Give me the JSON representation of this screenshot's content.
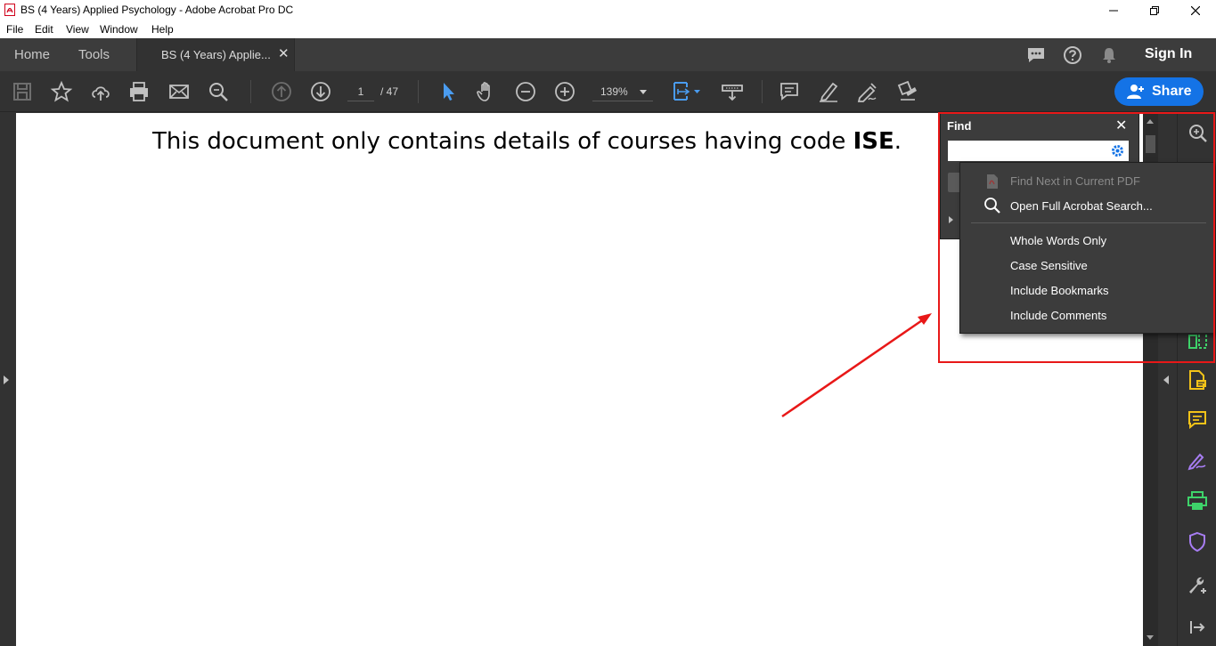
{
  "window": {
    "title": "BS (4 Years) Applied Psychology - Adobe Acrobat Pro DC",
    "controls": [
      "minimize",
      "restore",
      "close"
    ]
  },
  "menu": [
    "File",
    "Edit",
    "View",
    "Window",
    "Help"
  ],
  "tabs": {
    "home": "Home",
    "tools": "Tools",
    "document": "BS (4 Years) Applie...",
    "sign_in": "Sign In"
  },
  "toolbar": {
    "page_current": "1",
    "page_total": "/ 47",
    "zoom": "139%",
    "share_label": "Share",
    "accent_color": "#1473e6"
  },
  "document": {
    "text_prefix": "This document only contains details of courses having code ",
    "text_bold": "ISE",
    "text_suffix": "."
  },
  "find_panel": {
    "title": "Find",
    "search_value": ""
  },
  "find_menu": {
    "items": [
      {
        "label": "Find Next in Current PDF",
        "disabled": true,
        "icon": "pdf-doc-icon"
      },
      {
        "label": "Open Full Acrobat Search...",
        "disabled": false,
        "icon": "search-icon"
      },
      {
        "label": "Whole Words Only",
        "disabled": false
      },
      {
        "label": "Case Sensitive",
        "disabled": false
      },
      {
        "label": "Include Bookmarks",
        "disabled": false
      },
      {
        "label": "Include Comments",
        "disabled": false
      }
    ]
  },
  "annotation": {
    "highlight_color": "#e81818"
  }
}
